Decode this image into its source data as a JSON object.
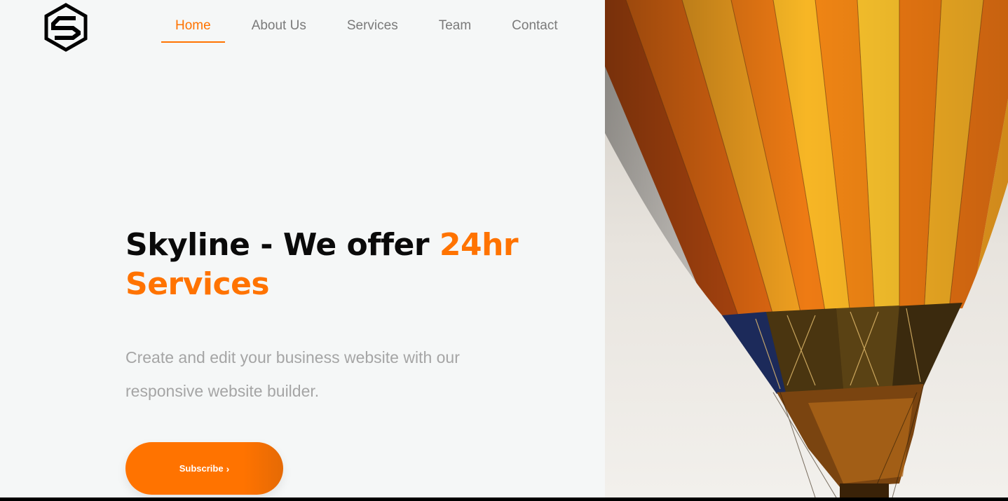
{
  "brand": {
    "logo_icon": "skyline-s-hexagon-icon"
  },
  "nav": {
    "items": [
      {
        "label": "Home",
        "active": true
      },
      {
        "label": "About Us",
        "active": false
      },
      {
        "label": "Services",
        "active": false
      },
      {
        "label": "Team",
        "active": false
      },
      {
        "label": "Contact",
        "active": false
      }
    ]
  },
  "hero": {
    "title_main": "Skyline - We offer ",
    "title_accent": "24hr Services",
    "subtitle": "Create and edit your business website with our responsive website builder.",
    "cta_label": "Subscribe",
    "cta_icon": "chevron-right-icon"
  },
  "colors": {
    "accent": "#ff7300",
    "background": "#f5f7f7",
    "title": "#0a0a0a",
    "subtitle": "#a5a5a5",
    "nav_text": "#7a7a7a"
  }
}
